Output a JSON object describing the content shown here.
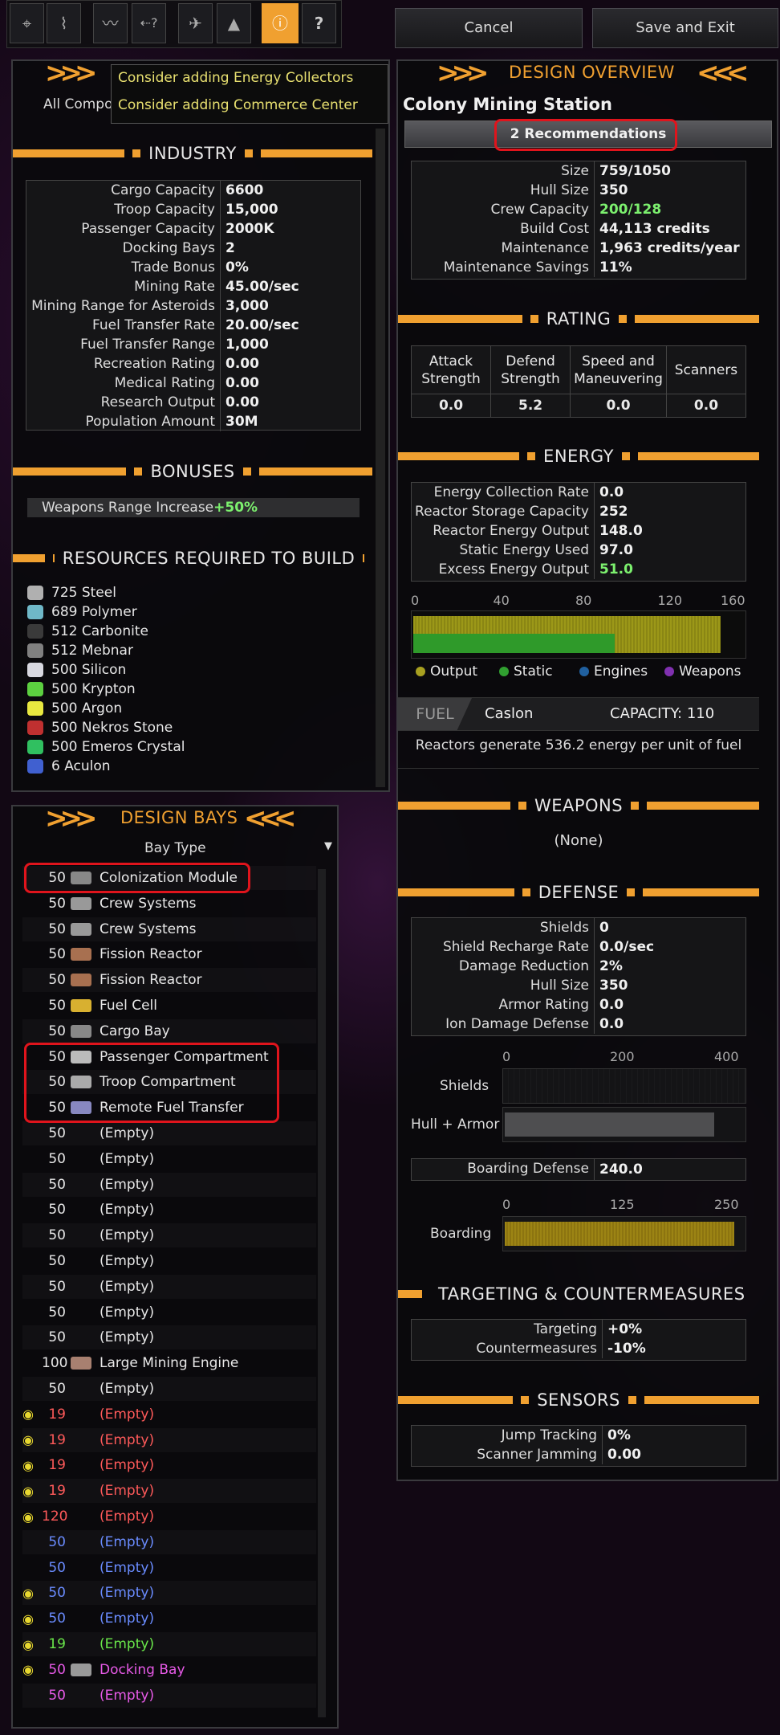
{
  "top_buttons": {
    "cancel": "Cancel",
    "save": "Save and Exit"
  },
  "toolbar": {
    "icons": [
      "crosshair-icon",
      "waveform-icon",
      "waveform-alt-icon",
      "arrow-question-icon",
      "ship-icon",
      "shapes-icon",
      "info-icon",
      "help-icon"
    ],
    "help_label": "?"
  },
  "tooltip": {
    "lines": [
      "Consider adding Energy Collectors",
      "Consider adding Commerce Center"
    ]
  },
  "components_filter": "All Compo",
  "industry": {
    "title": "INDUSTRY",
    "rows": [
      {
        "k": "Cargo Capacity",
        "v": "6600"
      },
      {
        "k": "Troop Capacity",
        "v": "15,000"
      },
      {
        "k": "Passenger Capacity",
        "v": "2000K"
      },
      {
        "k": "Docking Bays",
        "v": "2"
      },
      {
        "k": "Trade Bonus",
        "v": "0%"
      },
      {
        "k": "Mining Rate",
        "v": "45.00/sec"
      },
      {
        "k": "Mining Range for Asteroids",
        "v": "3,000"
      },
      {
        "k": "Fuel Transfer Rate",
        "v": "20.00/sec"
      },
      {
        "k": "Fuel Transfer Range",
        "v": "1,000"
      },
      {
        "k": "Recreation Rating",
        "v": "0.00"
      },
      {
        "k": "Medical Rating",
        "v": "0.00"
      },
      {
        "k": "Research Output",
        "v": "0.00"
      },
      {
        "k": "Population Amount",
        "v": "30M"
      }
    ]
  },
  "bonuses": {
    "title": "BONUSES",
    "label": "Weapons Range Increase",
    "value": "+50%"
  },
  "resources": {
    "title": "RESOURCES REQUIRED TO BUILD",
    "items": [
      {
        "text": "725 Steel",
        "color": "#b0b0b0"
      },
      {
        "text": "689 Polymer",
        "color": "#6fb8c8"
      },
      {
        "text": "512 Carbonite",
        "color": "#3a3a3a"
      },
      {
        "text": "512 Mebnar",
        "color": "#808080"
      },
      {
        "text": "500 Silicon",
        "color": "#d8d8e0"
      },
      {
        "text": "500 Krypton",
        "color": "#5cd040"
      },
      {
        "text": "500 Argon",
        "color": "#e8e840"
      },
      {
        "text": "500 Nekros Stone",
        "color": "#c03030"
      },
      {
        "text": "500 Emeros Crystal",
        "color": "#30c060"
      },
      {
        "text": "6 Aculon",
        "color": "#4060d0"
      }
    ]
  },
  "design_bays": {
    "title": "DESIGN BAYS",
    "column": "Bay Type",
    "rows": [
      {
        "eye": false,
        "size": "50",
        "name": "Colonization Module",
        "color": "#e8e8e8",
        "icon": "#888"
      },
      {
        "eye": false,
        "size": "50",
        "name": "Crew Systems",
        "color": "#e8e8e8",
        "icon": "#999"
      },
      {
        "eye": false,
        "size": "50",
        "name": "Crew Systems",
        "color": "#e8e8e8",
        "icon": "#999"
      },
      {
        "eye": false,
        "size": "50",
        "name": "Fission Reactor",
        "color": "#e8e8e8",
        "icon": "#a87050"
      },
      {
        "eye": false,
        "size": "50",
        "name": "Fission Reactor",
        "color": "#e8e8e8",
        "icon": "#a87050"
      },
      {
        "eye": false,
        "size": "50",
        "name": "Fuel Cell",
        "color": "#e8e8e8",
        "icon": "#d8b030"
      },
      {
        "eye": false,
        "size": "50",
        "name": "Cargo Bay",
        "color": "#e8e8e8",
        "icon": "#888"
      },
      {
        "eye": false,
        "size": "50",
        "name": "Passenger Compartment",
        "color": "#e8e8e8",
        "icon": "#bbb"
      },
      {
        "eye": false,
        "size": "50",
        "name": "Troop Compartment",
        "color": "#e8e8e8",
        "icon": "#aaa"
      },
      {
        "eye": false,
        "size": "50",
        "name": "Remote Fuel Transfer",
        "color": "#e8e8e8",
        "icon": "#8888c0"
      },
      {
        "eye": false,
        "size": "50",
        "name": "(Empty)",
        "color": "#e8e8e8",
        "icon": ""
      },
      {
        "eye": false,
        "size": "50",
        "name": "(Empty)",
        "color": "#e8e8e8",
        "icon": ""
      },
      {
        "eye": false,
        "size": "50",
        "name": "(Empty)",
        "color": "#e8e8e8",
        "icon": ""
      },
      {
        "eye": false,
        "size": "50",
        "name": "(Empty)",
        "color": "#e8e8e8",
        "icon": ""
      },
      {
        "eye": false,
        "size": "50",
        "name": "(Empty)",
        "color": "#e8e8e8",
        "icon": ""
      },
      {
        "eye": false,
        "size": "50",
        "name": "(Empty)",
        "color": "#e8e8e8",
        "icon": ""
      },
      {
        "eye": false,
        "size": "50",
        "name": "(Empty)",
        "color": "#e8e8e8",
        "icon": ""
      },
      {
        "eye": false,
        "size": "50",
        "name": "(Empty)",
        "color": "#e8e8e8",
        "icon": ""
      },
      {
        "eye": false,
        "size": "50",
        "name": "(Empty)",
        "color": "#e8e8e8",
        "icon": ""
      },
      {
        "eye": false,
        "size": "100",
        "name": "Large Mining Engine",
        "color": "#e8e8e8",
        "icon": "#a88070"
      },
      {
        "eye": false,
        "size": "50",
        "name": "(Empty)",
        "color": "#e8e8e8",
        "icon": ""
      },
      {
        "eye": true,
        "size": "19",
        "name": "(Empty)",
        "color": "#ff5a5a",
        "icon": ""
      },
      {
        "eye": true,
        "size": "19",
        "name": "(Empty)",
        "color": "#ff5a5a",
        "icon": ""
      },
      {
        "eye": true,
        "size": "19",
        "name": "(Empty)",
        "color": "#ff5a5a",
        "icon": ""
      },
      {
        "eye": true,
        "size": "19",
        "name": "(Empty)",
        "color": "#ff5a5a",
        "icon": ""
      },
      {
        "eye": true,
        "size": "120",
        "name": "(Empty)",
        "color": "#ff5a5a",
        "icon": ""
      },
      {
        "eye": false,
        "size": "50",
        "name": "(Empty)",
        "color": "#6a8cff",
        "icon": ""
      },
      {
        "eye": false,
        "size": "50",
        "name": "(Empty)",
        "color": "#6a8cff",
        "icon": ""
      },
      {
        "eye": true,
        "size": "50",
        "name": "(Empty)",
        "color": "#6a8cff",
        "icon": ""
      },
      {
        "eye": true,
        "size": "50",
        "name": "(Empty)",
        "color": "#6a8cff",
        "icon": ""
      },
      {
        "eye": true,
        "size": "19",
        "name": "(Empty)",
        "color": "#6ae84a",
        "icon": ""
      },
      {
        "eye": true,
        "size": "50",
        "name": "Docking Bay",
        "color": "#e85ae8",
        "icon": "#999"
      },
      {
        "eye": false,
        "size": "50",
        "name": "(Empty)",
        "color": "#e85ae8",
        "icon": ""
      }
    ]
  },
  "overview": {
    "title": "DESIGN OVERVIEW",
    "design_name": "Colony Mining Station",
    "recommendations": "2 Recommendations",
    "stats": [
      {
        "k": "Size",
        "v": "759/1050",
        "green": false
      },
      {
        "k": "Hull Size",
        "v": "350",
        "green": false
      },
      {
        "k": "Crew Capacity",
        "v": "200/128",
        "green": true
      },
      {
        "k": "Build Cost",
        "v": "44,113 credits",
        "green": false
      },
      {
        "k": "Maintenance",
        "v": "1,963 credits/year",
        "green": false
      },
      {
        "k": "Maintenance Savings",
        "v": "11%",
        "green": false
      }
    ]
  },
  "rating": {
    "title": "RATING",
    "cols": [
      {
        "h": "Attack Strength",
        "v": "0.0"
      },
      {
        "h": "Defend Strength",
        "v": "5.2"
      },
      {
        "h": "Speed and Maneuvering",
        "v": "0.0"
      },
      {
        "h": "Scanners",
        "v": "0.0"
      }
    ]
  },
  "energy": {
    "title": "ENERGY",
    "rows": [
      {
        "k": "Energy Collection Rate",
        "v": "0.0",
        "green": false
      },
      {
        "k": "Reactor Storage Capacity",
        "v": "252",
        "green": false
      },
      {
        "k": "Reactor Energy Output",
        "v": "148.0",
        "green": false
      },
      {
        "k": "Static Energy Used",
        "v": "97.0",
        "green": false
      },
      {
        "k": "Excess Energy Output",
        "v": "51.0",
        "green": true
      }
    ],
    "chart": {
      "ticks": [
        "0",
        "40",
        "80",
        "120",
        "160"
      ],
      "axis_max": 160,
      "output": 148.0,
      "static": 97.0
    },
    "legend": [
      {
        "label": "Output",
        "color": "#a8a020"
      },
      {
        "label": "Static",
        "color": "#30a030"
      },
      {
        "label": "Engines",
        "color": "#2060a0"
      },
      {
        "label": "Weapons",
        "color": "#8030b0"
      }
    ]
  },
  "fuel": {
    "label": "FUEL",
    "type": "Caslon",
    "capacity": "CAPACITY: 110",
    "note": "Reactors generate 536.2 energy per unit of fuel"
  },
  "weapons": {
    "title": "WEAPONS",
    "value": "(None)"
  },
  "defense": {
    "title": "DEFENSE",
    "rows": [
      {
        "k": "Shields",
        "v": "0"
      },
      {
        "k": "Shield Recharge Rate",
        "v": "0.0/sec"
      },
      {
        "k": "Damage Reduction",
        "v": "2%"
      },
      {
        "k": "Hull Size",
        "v": "350"
      },
      {
        "k": "Armor Rating",
        "v": "0.0"
      },
      {
        "k": "Ion Damage Defense",
        "v": "0.0"
      }
    ],
    "bar_ticks": [
      "0",
      "200",
      "400"
    ],
    "bar_max": 400,
    "shields_label": "Shields",
    "shields_value": 0,
    "hull_label": "Hull + Armor",
    "hull_value": 350,
    "boarding_defense_k": "Boarding Defense",
    "boarding_defense_v": "240.0",
    "boarding_ticks": [
      "0",
      "125",
      "250"
    ],
    "boarding_max": 250,
    "boarding_label": "Boarding",
    "boarding_value": 240
  },
  "targeting": {
    "title": "TARGETING & COUNTERMEASURES",
    "rows": [
      {
        "k": "Targeting",
        "v": "+0%"
      },
      {
        "k": "Countermeasures",
        "v": "-10%"
      }
    ]
  },
  "sensors": {
    "title": "SENSORS",
    "rows": [
      {
        "k": "Jump Tracking",
        "v": "0%"
      },
      {
        "k": "Scanner Jamming",
        "v": "0.00"
      }
    ]
  }
}
